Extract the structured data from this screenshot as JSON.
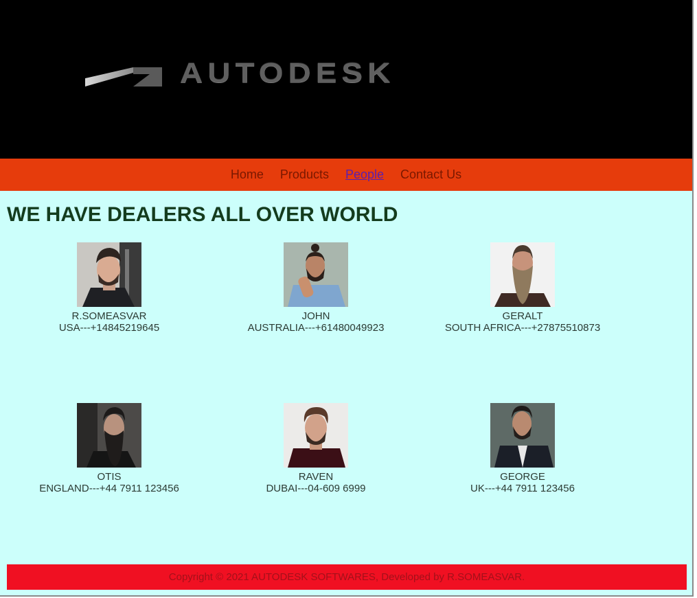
{
  "header": {
    "logo_text": "AUTODESK",
    "logo_icon": "autodesk-logo-mark"
  },
  "nav": {
    "items": [
      {
        "label": "Home"
      },
      {
        "label": "Products"
      },
      {
        "label": "People",
        "active": true
      },
      {
        "label": "Contact Us"
      }
    ]
  },
  "main": {
    "heading": "WE HAVE DEALERS ALL OVER WORLD",
    "dealers": [
      {
        "name": "R.SOMEASVAR",
        "contact": "USA---+14845219645"
      },
      {
        "name": "JOHN",
        "contact": "AUSTRALIA---+61480049923"
      },
      {
        "name": "GERALT",
        "contact": "SOUTH AFRICA---+27875510873"
      },
      {
        "name": "OTIS",
        "contact": "ENGLAND---+44 7911 123456"
      },
      {
        "name": "RAVEN",
        "contact": "DUBAI---04-609 6999"
      },
      {
        "name": "GEORGE",
        "contact": "UK---+44 7911 123456"
      }
    ]
  },
  "footer": {
    "text": "Copyright © 2021 AUTODESK SOFTWARES, Developed by R.SOMEASVAR."
  },
  "colors": {
    "banner": "#000000",
    "nav": "#e63c0c",
    "content_bg": "#ccfffb",
    "footer": "#f01022"
  }
}
